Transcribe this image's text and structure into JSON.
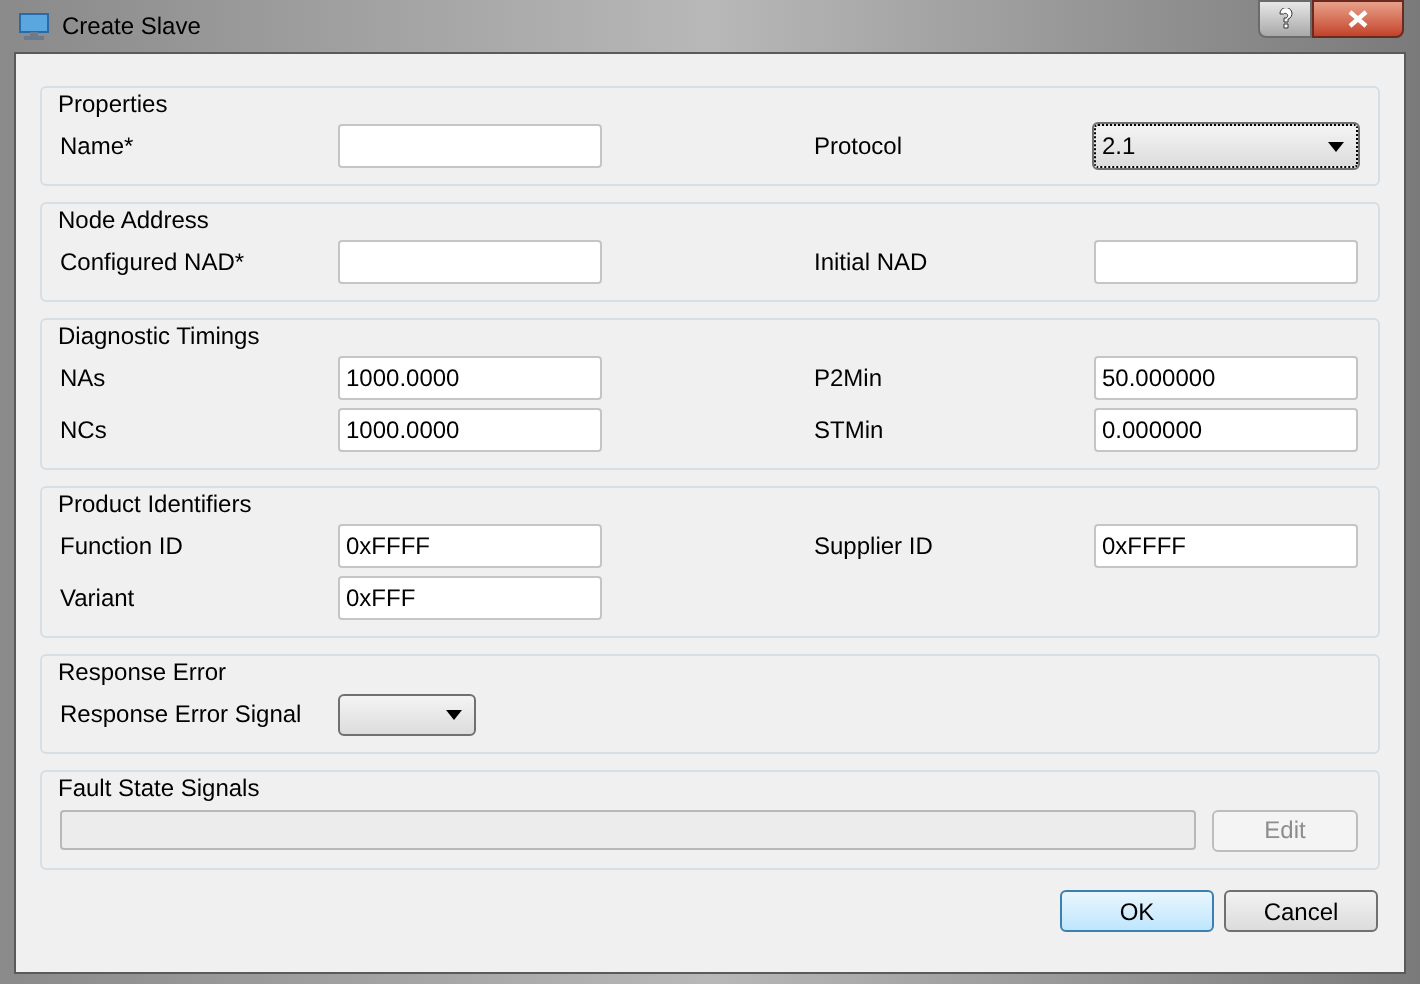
{
  "window": {
    "title": "Create Slave"
  },
  "sections": [
    {
      "title": "Properties",
      "rows": [
        [
          {
            "label": "Name*",
            "kind": "text"
          },
          {
            "label": "Protocol",
            "kind": "combo",
            "value": "2.1",
            "focused": true
          }
        ]
      ]
    },
    {
      "title": "Node Address",
      "rows": [
        [
          {
            "label": "Configured NAD*",
            "kind": "text"
          },
          {
            "label": "Initial NAD",
            "kind": "text"
          }
        ]
      ]
    },
    {
      "title": "Diagnostic Timings",
      "rows": [
        [
          {
            "label": "NAs",
            "kind": "text",
            "value": "1000.0000"
          },
          {
            "label": "P2Min",
            "kind": "text",
            "value": "50.000000"
          }
        ],
        [
          {
            "label": "NCs",
            "kind": "text",
            "value": "1000.0000"
          },
          {
            "label": "STMin",
            "kind": "text",
            "value": "0.000000"
          }
        ]
      ]
    },
    {
      "title": "Product Identifiers",
      "rows": [
        [
          {
            "label": "Function ID",
            "kind": "text",
            "value": "0xFFFF"
          },
          {
            "label": "Supplier ID",
            "kind": "text",
            "value": "0xFFFF"
          }
        ],
        [
          {
            "label": "Variant",
            "kind": "text",
            "value": "0xFFF"
          }
        ]
      ]
    },
    {
      "title": "Response Error",
      "rows": [
        [
          {
            "label": "Response Error Signal",
            "kind": "small-combo"
          }
        ]
      ]
    },
    {
      "title": "Fault State Signals",
      "rows": [
        [
          {
            "kind": "list",
            "button": {
              "label": "Edit",
              "disabled": true
            }
          }
        ]
      ]
    }
  ],
  "buttons": [
    {
      "label": "OK",
      "default": true
    },
    {
      "label": "Cancel",
      "default": false
    }
  ]
}
